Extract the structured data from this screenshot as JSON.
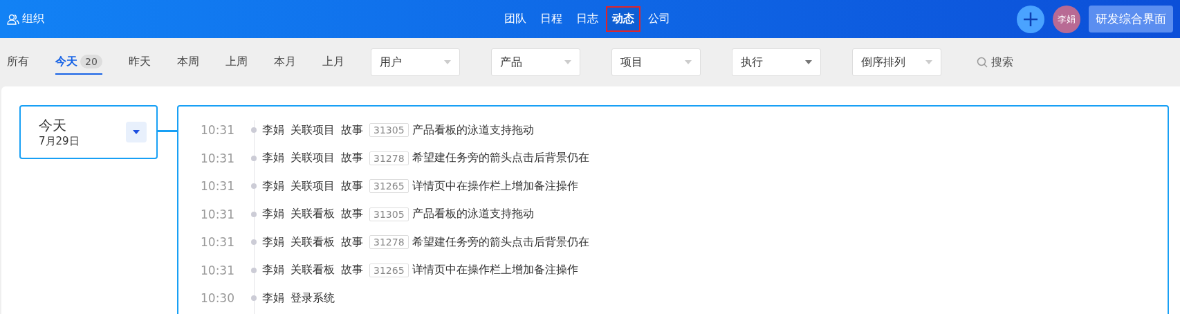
{
  "header": {
    "org": "组织",
    "nav": [
      {
        "label": "团队",
        "selected": false
      },
      {
        "label": "日程",
        "selected": false
      },
      {
        "label": "日志",
        "selected": false
      },
      {
        "label": "动态",
        "selected": true
      },
      {
        "label": "公司",
        "selected": false
      }
    ],
    "avatar": "李娟",
    "workspace": "研发综合界面"
  },
  "filters": {
    "periods": [
      {
        "label": "所有",
        "selected": false
      },
      {
        "label": "今天",
        "selected": true,
        "count": "20"
      },
      {
        "label": "昨天",
        "selected": false
      },
      {
        "label": "本周",
        "selected": false
      },
      {
        "label": "上周",
        "selected": false
      },
      {
        "label": "本月",
        "selected": false
      },
      {
        "label": "上月",
        "selected": false
      }
    ],
    "dropdowns": [
      "用户",
      "产品",
      "项目",
      "执行",
      "倒序排列"
    ],
    "search": "搜索"
  },
  "day": {
    "title": "今天",
    "date": "7月29日"
  },
  "entries": [
    {
      "time": "10:31",
      "actor": "李娟",
      "action": "关联项目",
      "type": "故事",
      "id": "31305",
      "title": "产品看板的泳道支持拖动"
    },
    {
      "time": "10:31",
      "actor": "李娟",
      "action": "关联项目",
      "type": "故事",
      "id": "31278",
      "title": "希望建任务旁的箭头点击后背景仍在"
    },
    {
      "time": "10:31",
      "actor": "李娟",
      "action": "关联项目",
      "type": "故事",
      "id": "31265",
      "title": "详情页中在操作栏上增加备注操作"
    },
    {
      "time": "10:31",
      "actor": "李娟",
      "action": "关联看板",
      "type": "故事",
      "id": "31305",
      "title": "产品看板的泳道支持拖动"
    },
    {
      "time": "10:31",
      "actor": "李娟",
      "action": "关联看板",
      "type": "故事",
      "id": "31278",
      "title": "希望建任务旁的箭头点击后背景仍在"
    },
    {
      "time": "10:31",
      "actor": "李娟",
      "action": "关联看板",
      "type": "故事",
      "id": "31265",
      "title": "详情页中在操作栏上增加备注操作"
    },
    {
      "time": "10:30",
      "actor": "李娟",
      "action": "登录系统"
    }
  ]
}
